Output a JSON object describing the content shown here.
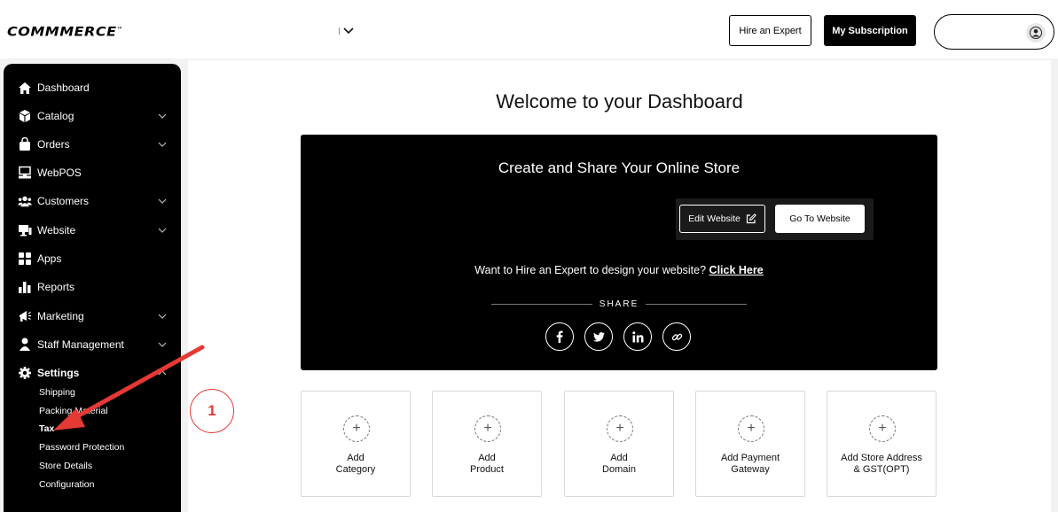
{
  "header": {
    "logo": "COMMMERCE",
    "logo_tm": "™",
    "hire_label": "Hire an Expert",
    "subscription_label": "My Subscription"
  },
  "sidebar": {
    "items": [
      {
        "label": "Dashboard",
        "icon": "home-icon"
      },
      {
        "label": "Catalog",
        "icon": "box-icon"
      },
      {
        "label": "Orders",
        "icon": "bag-icon"
      },
      {
        "label": "WebPOS",
        "icon": "pos-icon"
      },
      {
        "label": "Customers",
        "icon": "users-icon"
      },
      {
        "label": "Website",
        "icon": "monitor-icon"
      },
      {
        "label": "Apps",
        "icon": "grid-icon"
      },
      {
        "label": "Reports",
        "icon": "bar-chart-icon"
      },
      {
        "label": "Marketing",
        "icon": "megaphone-icon"
      },
      {
        "label": "Staff Management",
        "icon": "staff-icon"
      },
      {
        "label": "Settings",
        "icon": "gear-icon"
      }
    ],
    "settings_sub": [
      "Shipping",
      "Packing Material",
      "Tax",
      "Password Protection",
      "Store Details",
      "Configuration"
    ]
  },
  "main": {
    "welcome": "Welcome to your Dashboard",
    "hero_title": "Create and Share Your Online Store",
    "edit_website": "Edit Website",
    "go_to_website": "Go To Website",
    "hire_text": "Want to Hire an Expert to design your website?",
    "click_here": "Click Here",
    "share": "SHARE",
    "cards": [
      {
        "line1": "Add",
        "line2": "Category"
      },
      {
        "line1": "Add",
        "line2": "Product"
      },
      {
        "line1": "Add",
        "line2": "Domain"
      },
      {
        "line1": "Add Payment",
        "line2": "Gateway"
      },
      {
        "line1": "Add Store Address",
        "line2": "& GST(OPT)"
      }
    ]
  },
  "annotation": {
    "step": "1",
    "color": "#e53935"
  }
}
